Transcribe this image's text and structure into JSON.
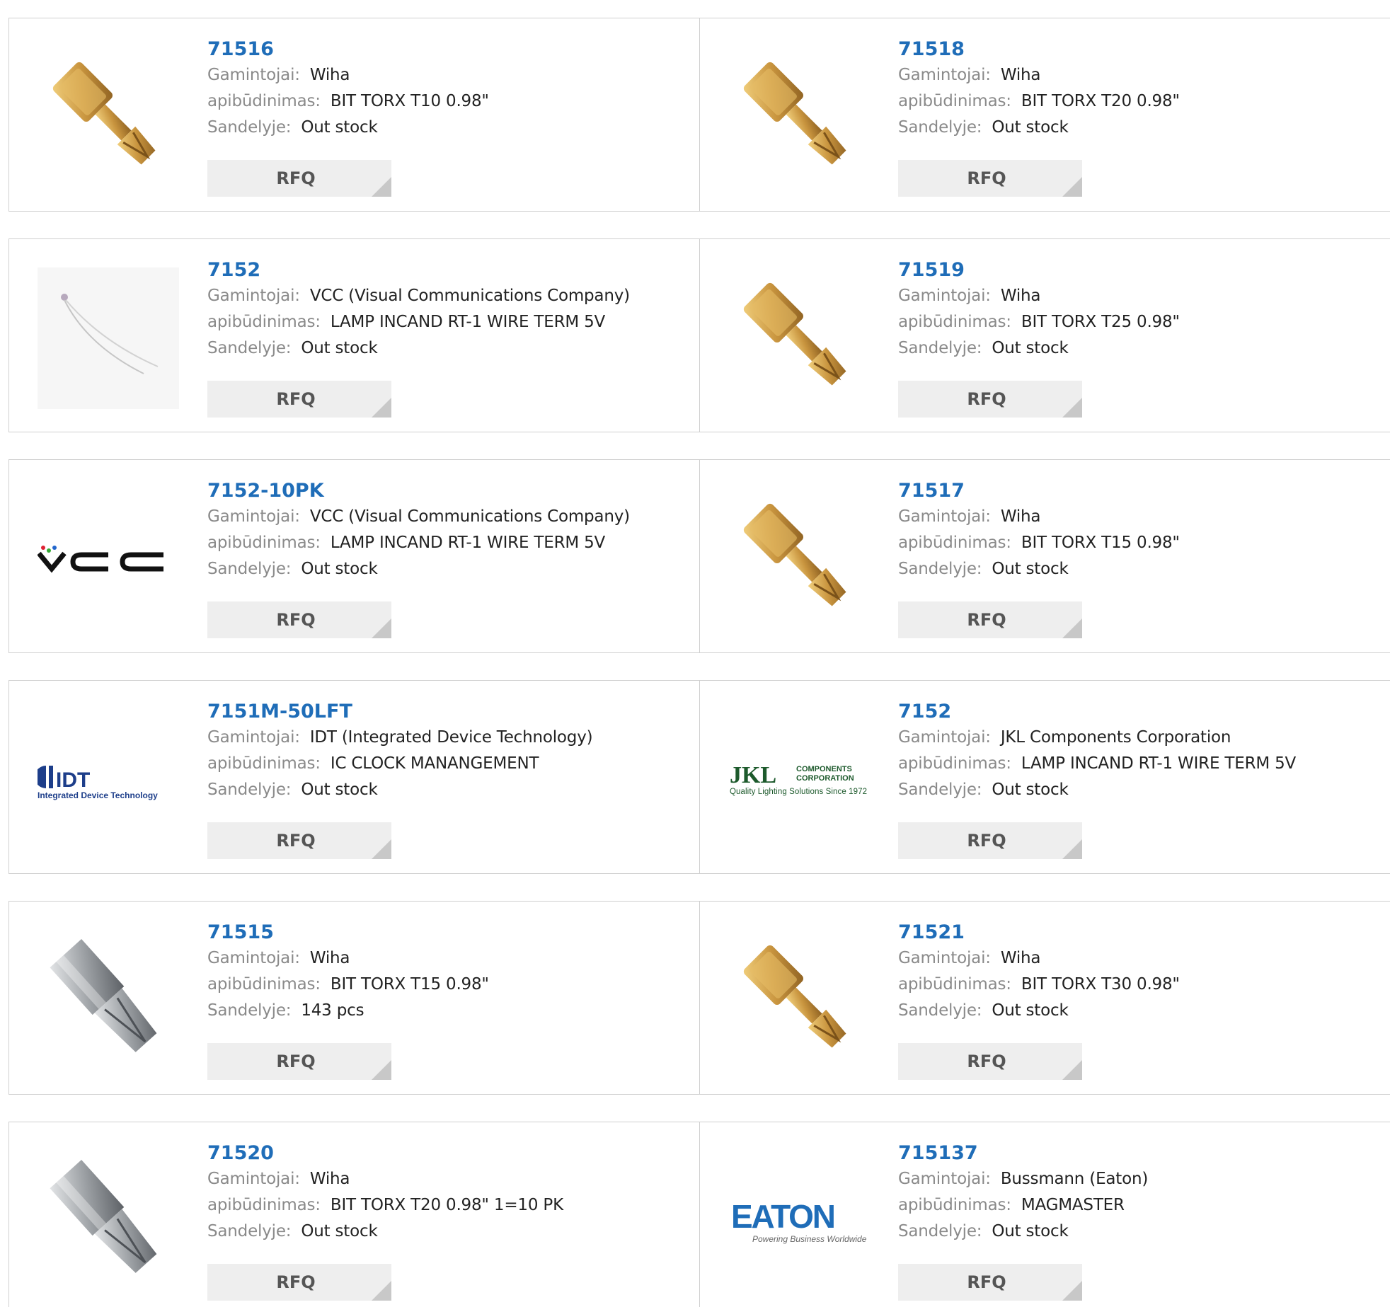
{
  "labels": {
    "manufacturer": "Gamintojai:",
    "description": "apibūdinimas:",
    "stock": "Sandelyje:",
    "rfq": "RFQ"
  },
  "products": [
    {
      "part": "71516",
      "manufacturer": "Wiha",
      "description": "BIT TORX T10 0.98\"",
      "stock": "Out stock",
      "image": "gold-torx-bit-icon"
    },
    {
      "part": "71518",
      "manufacturer": "Wiha",
      "description": "BIT TORX T20 0.98\"",
      "stock": "Out stock",
      "image": "gold-torx-bit-icon"
    },
    {
      "part": "7152",
      "manufacturer": "VCC (Visual Communications Company)",
      "description": "LAMP INCAND RT-1 WIRE TERM 5V",
      "stock": "Out stock",
      "image": "wire-lamp-icon"
    },
    {
      "part": "71519",
      "manufacturer": "Wiha",
      "description": "BIT TORX T25 0.98\"",
      "stock": "Out stock",
      "image": "gold-torx-bit-icon"
    },
    {
      "part": "7152-10PK",
      "manufacturer": "VCC (Visual Communications Company)",
      "description": "LAMP INCAND RT-1 WIRE TERM 5V",
      "stock": "Out stock",
      "image": "vcc-logo"
    },
    {
      "part": "71517",
      "manufacturer": "Wiha",
      "description": "BIT TORX T15 0.98\"",
      "stock": "Out stock",
      "image": "gold-torx-bit-icon"
    },
    {
      "part": "7151M-50LFT",
      "manufacturer": "IDT (Integrated Device Technology)",
      "description": "IC CLOCK MANANGEMENT",
      "stock": "Out stock",
      "image": "idt-logo"
    },
    {
      "part": "7152",
      "manufacturer": "JKL Components Corporation",
      "description": "LAMP INCAND RT-1 WIRE TERM 5V",
      "stock": "Out stock",
      "image": "jkl-logo"
    },
    {
      "part": "71515",
      "manufacturer": "Wiha",
      "description": "BIT TORX T15 0.98\"",
      "stock": "143 pcs",
      "image": "silver-torx-bit-icon"
    },
    {
      "part": "71521",
      "manufacturer": "Wiha",
      "description": "BIT TORX T30 0.98\"",
      "stock": "Out stock",
      "image": "gold-torx-bit-icon"
    },
    {
      "part": "71520",
      "manufacturer": "Wiha",
      "description": "BIT TORX T20 0.98\" 1=10 PK",
      "stock": "Out stock",
      "image": "silver-torx-bit-icon"
    },
    {
      "part": "715137",
      "manufacturer": "Bussmann (Eaton)",
      "description": "MAGMASTER",
      "stock": "Out stock",
      "image": "eaton-logo"
    }
  ],
  "logos": {
    "idt": {
      "mark": "IDT",
      "tagline": "Integrated Device Technology"
    },
    "jkl": {
      "mark": "JKL",
      "sub1": "COMPONENTS",
      "sub2": "CORPORATION",
      "tagline": "Quality Lighting Solutions Since 1972"
    },
    "eaton": {
      "mark": "EATON",
      "tagline": "Powering Business Worldwide"
    },
    "vcc": {
      "mark": "VCC"
    }
  },
  "colors": {
    "link": "#1f6db8",
    "label": "#8a8a8a",
    "button_bg": "#eeeeee",
    "border": "#cfcfcf"
  }
}
